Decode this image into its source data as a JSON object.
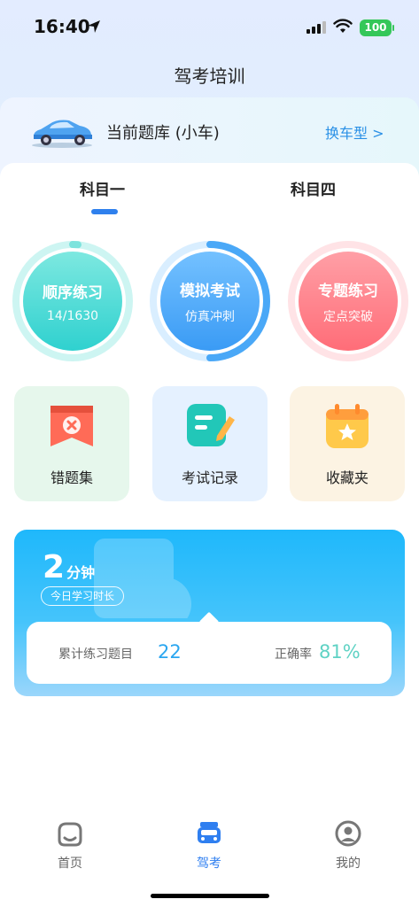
{
  "status_bar": {
    "time": "16:40",
    "battery": "100"
  },
  "nav": {
    "title": "驾考培训"
  },
  "question_bank": {
    "title": "当前题库 (小车)",
    "switch_label": "换车型 >"
  },
  "subject_tabs": [
    {
      "label": "科目一",
      "active": true
    },
    {
      "label": "科目四",
      "active": false
    }
  ],
  "practice": {
    "sequential": {
      "title": "顺序练习",
      "sub": "14/1630",
      "progress": 0.0086
    },
    "mock_exam": {
      "title": "模拟考试",
      "sub": "仿真冲刺"
    },
    "topic": {
      "title": "专题练习",
      "sub": "定点突破"
    }
  },
  "tiles": [
    {
      "label": "错题集",
      "icon": "wrong-questions-icon"
    },
    {
      "label": "考试记录",
      "icon": "exam-record-icon"
    },
    {
      "label": "收藏夹",
      "icon": "favorites-icon"
    }
  ],
  "study": {
    "minutes_value": "2",
    "minutes_unit": "分钟",
    "today_label": "今日学习时长",
    "total_label": "累计练习题目",
    "total_value": "22",
    "accuracy_label": "正确率",
    "accuracy_value": "81%"
  },
  "tabbar": [
    {
      "label": "首页",
      "icon": "home-icon",
      "active": false
    },
    {
      "label": "驾考",
      "icon": "car-icon",
      "active": true
    },
    {
      "label": "我的",
      "icon": "profile-icon",
      "active": false
    }
  ],
  "colors": {
    "accent": "#2f7ff0",
    "sequential": "#2fd1cf",
    "mock": "#3a9bf5",
    "topic": "#ff6d78"
  }
}
